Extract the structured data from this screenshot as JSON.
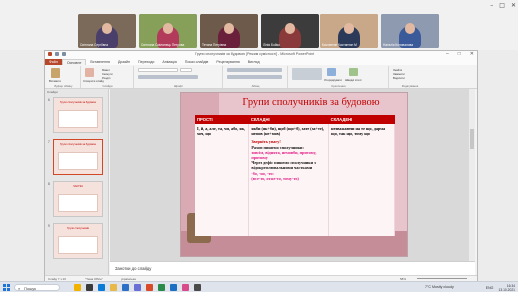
{
  "meeting": {
    "window_controls": [
      "–",
      "□",
      "✕"
    ],
    "participants": [
      {
        "name": "Світлана Сергіївна",
        "bg": "#7b6a5a",
        "shirt": "#4a3f6b"
      },
      {
        "name": "Світлана Смілянець Петрова",
        "bg": "#86a05a",
        "shirt": "#b23a5a"
      },
      {
        "name": "Тетяна Петрівна",
        "bg": "#6e5a4a",
        "shirt": "#6a1f3a"
      },
      {
        "name": "Лiлiя Бойко",
        "bg": "#3c3c3c",
        "shirt": "#8a3a3a"
      },
      {
        "name": "Костянтин Костянтин М",
        "bg": "#c9a88a",
        "shirt": "#2c3a5a"
      },
      {
        "name": "Наталія Коновалова",
        "bg": "#8e9ab0",
        "shirt": "#3a5a9a"
      }
    ]
  },
  "ppt": {
    "window_title": "Групи сполучників за будовою [Режим сумісності] - Microsoft PowerPoint",
    "tabs": [
      "Файл",
      "Основне",
      "Вставлення",
      "Дизайн",
      "Переходи",
      "Анімація",
      "Показ слайдів",
      "Рецензування",
      "Вигляд"
    ],
    "ribbon": {
      "groups": [
        "Буфер обміну",
        "Слайди",
        "Шрифт",
        "Абзац",
        "Креслення",
        "Редагування"
      ],
      "buttons": [
        "Вставити",
        "Створити слайд",
        "Макет",
        "Скинути",
        "Розділ",
        "Упорядкувати",
        "Швидкі стилі",
        "Знайти",
        "Замінити",
        "Виділити"
      ]
    },
    "thumbnails_header": "Слайди",
    "thumbnails": [
      {
        "num": "6",
        "title": "Групи сполучників за будовою"
      },
      {
        "num": "7",
        "title": "Групи сполучників за будовою"
      },
      {
        "num": "8",
        "title": "ЧАСТКА"
      },
      {
        "num": "9",
        "title": "Групи сполучників"
      }
    ],
    "slide": {
      "title": "Групи сполучників за будовою",
      "headers": [
        "ПРОСТІ",
        "СКЛАДНІ",
        "СКЛАДЕНІ"
      ],
      "col1": "І, й, а, але, та, чи, або, як, хоч, що",
      "col2_top": "якби (як+би), щоб (що+б), зате (за+те), немов (не+мов)",
      "col2_note_title": "Зверніть увагу!",
      "col2_note_1": "Разом пишемо сполучники:",
      "col2_note_2": "зовсім, віднята, немовби, притому, причому",
      "col2_note_3": "Через дефіс пишемо сполучники з",
      "col2_note_4": "відокремлювальними частками",
      "col2_note_5": "-бо, -но, -то:",
      "col2_note_6": "(все-то, отже-то, тому-то)",
      "col3": "незважаючи на те що, дарма що, так що, тому що"
    },
    "notes_placeholder": "Занотки до слайду",
    "status": {
      "slide_counter": "Слайд 7 з 10",
      "theme": "\"Тема Office\"",
      "language": "українська",
      "zoom": "58%"
    }
  },
  "taskbar": {
    "search_label": "Пошук",
    "weather": "7°C  Mostly cloudy",
    "lang": "ENG",
    "time": "16:34",
    "date": "13.10.2021"
  }
}
